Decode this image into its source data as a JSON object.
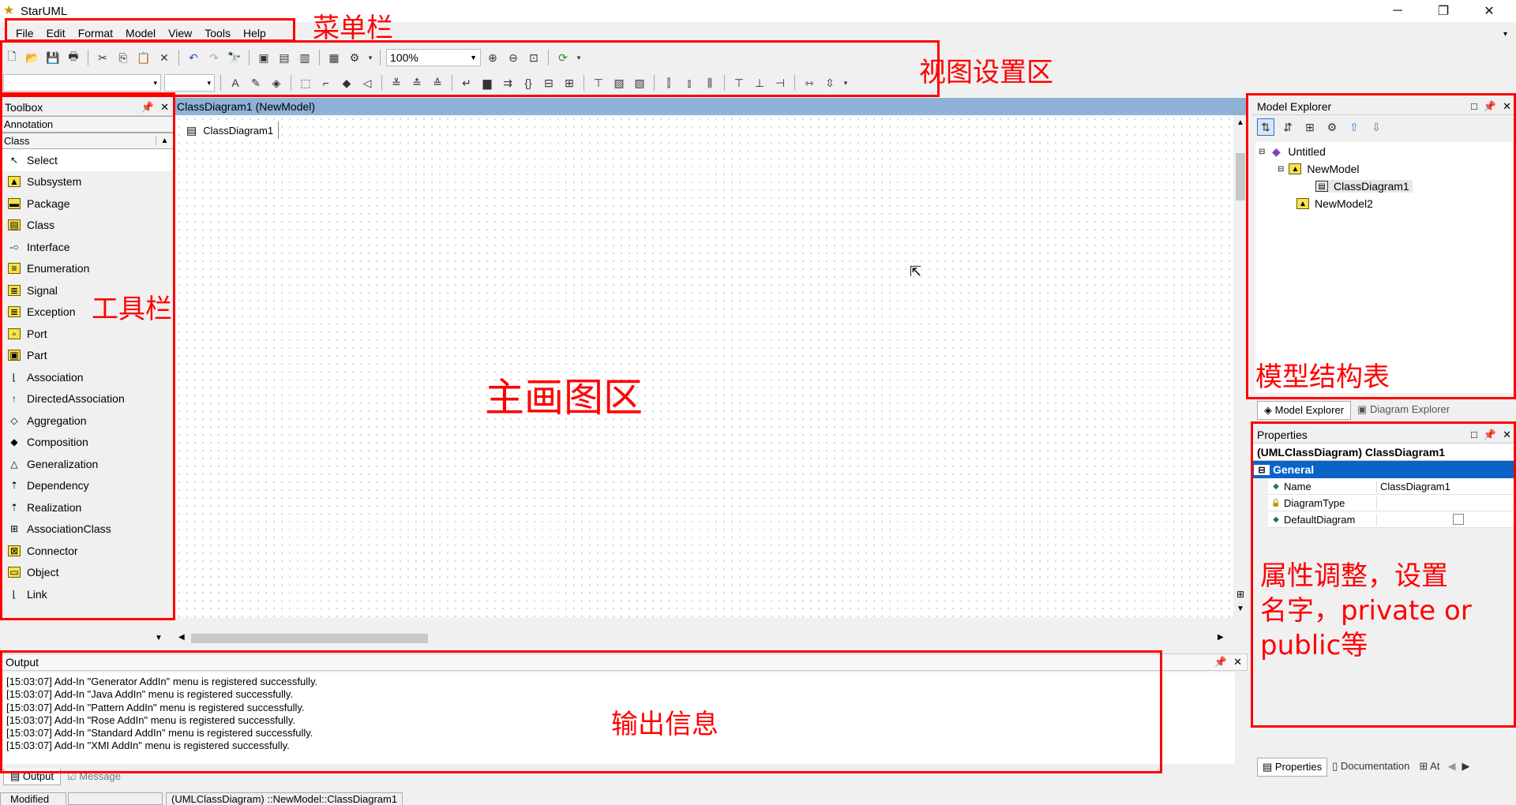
{
  "window": {
    "title": "StarUML",
    "minimize": "─",
    "restore": "❐",
    "close": "✕"
  },
  "menu": {
    "items": [
      "File",
      "Edit",
      "Format",
      "Model",
      "View",
      "Tools",
      "Help"
    ]
  },
  "toolbar": {
    "zoom_value": "100%"
  },
  "toolbox": {
    "title": "Toolbox",
    "sections": [
      "Annotation",
      "Class"
    ],
    "items": [
      {
        "label": "Select",
        "icon": "cursor-icon"
      },
      {
        "label": "Subsystem",
        "icon": "subsystem-icon"
      },
      {
        "label": "Package",
        "icon": "package-icon"
      },
      {
        "label": "Class",
        "icon": "class-icon"
      },
      {
        "label": "Interface",
        "icon": "interface-icon"
      },
      {
        "label": "Enumeration",
        "icon": "enumeration-icon"
      },
      {
        "label": "Signal",
        "icon": "signal-icon"
      },
      {
        "label": "Exception",
        "icon": "exception-icon"
      },
      {
        "label": "Port",
        "icon": "port-icon"
      },
      {
        "label": "Part",
        "icon": "part-icon"
      },
      {
        "label": "Association",
        "icon": "association-icon"
      },
      {
        "label": "DirectedAssociation",
        "icon": "directed-association-icon"
      },
      {
        "label": "Aggregation",
        "icon": "aggregation-icon"
      },
      {
        "label": "Composition",
        "icon": "composition-icon"
      },
      {
        "label": "Generalization",
        "icon": "generalization-icon"
      },
      {
        "label": "Dependency",
        "icon": "dependency-icon"
      },
      {
        "label": "Realization",
        "icon": "realization-icon"
      },
      {
        "label": "AssociationClass",
        "icon": "association-class-icon"
      },
      {
        "label": "Connector",
        "icon": "connector-icon"
      },
      {
        "label": "Object",
        "icon": "object-icon"
      },
      {
        "label": "Link",
        "icon": "link-icon"
      }
    ]
  },
  "diagram": {
    "title": "ClassDiagram1 (NewModel)",
    "tab": "ClassDiagram1"
  },
  "output": {
    "title": "Output",
    "lines": [
      "[15:03:07]  Add-In \"Generator AddIn\" menu is registered successfully.",
      "[15:03:07]  Add-In \"Java AddIn\" menu is registered successfully.",
      "[15:03:07]  Add-In \"Pattern AddIn\" menu is registered successfully.",
      "[15:03:07]  Add-In \"Rose AddIn\" menu is registered successfully.",
      "[15:03:07]  Add-In \"Standard AddIn\" menu is registered successfully.",
      "[15:03:07]  Add-In \"XMI AddIn\" menu is registered successfully."
    ],
    "tabs": [
      "Output",
      "Message"
    ]
  },
  "model_explorer": {
    "title": "Model Explorer",
    "tree": [
      "Untitled",
      "NewModel",
      "ClassDiagram1",
      "NewModel2"
    ],
    "tabs": [
      "Model Explorer",
      "Diagram Explorer"
    ]
  },
  "properties": {
    "title": "Properties",
    "heading": "(UMLClassDiagram) ClassDiagram1",
    "group": "General",
    "rows": [
      {
        "name": "Name",
        "value": "ClassDiagram1"
      },
      {
        "name": "DiagramType",
        "value": ""
      },
      {
        "name": "DefaultDiagram",
        "value": ""
      }
    ],
    "tabs": [
      "Properties",
      "Documentation",
      "At"
    ]
  },
  "status": {
    "state": "Modified",
    "path": "(UMLClassDiagram) ::NewModel::ClassDiagram1"
  },
  "annotations": {
    "menubar": "菜单栏",
    "viewarea": "视图设置区",
    "toolbox": "工具栏",
    "canvas": "主画图区",
    "model": "模型结构表",
    "props_line1": "属性调整，设置",
    "props_line2": "名字，private or",
    "props_line3": "public等",
    "output": "输出信息"
  },
  "colors": {
    "annotation": "#ff0000",
    "diagram_title_bg": "#8fb1d8",
    "selection": "#0a64c8"
  }
}
